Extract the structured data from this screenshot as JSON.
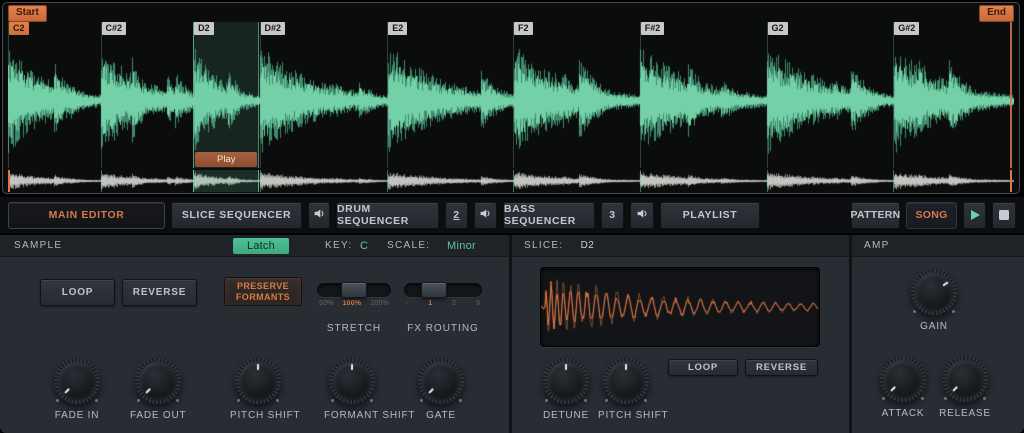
{
  "colors": {
    "accent_orange": "#d9784a",
    "accent_teal": "#5cc8a2",
    "main_wave_dark": "#3f8b6d",
    "main_wave": "#74d0a7",
    "overview_wave_dark": "#8f918d",
    "overview_wave": "#c2c4c0",
    "slice_wave": "#e07a45"
  },
  "waveform_panel": {
    "start_label": "Start",
    "end_label": "End",
    "play_label": "Play",
    "selected_slice": "D2",
    "end_pos": 0.996,
    "slices": [
      {
        "label": "C2",
        "pos": 0.0
      },
      {
        "label": "C#2",
        "pos": 0.092
      },
      {
        "label": "D2",
        "pos": 0.184
      },
      {
        "label": "D#2",
        "pos": 0.25
      },
      {
        "label": "E2",
        "pos": 0.377
      },
      {
        "label": "F2",
        "pos": 0.502
      },
      {
        "label": "F#2",
        "pos": 0.628
      },
      {
        "label": "G2",
        "pos": 0.754
      },
      {
        "label": "G#2",
        "pos": 0.88
      }
    ]
  },
  "tab_bar": {
    "main_editor": "MAIN EDITOR",
    "slice_sequencer": "SLICE SEQUENCER",
    "drum_sequencer": "DRUM SEQUENCER",
    "drum_index": "2",
    "bass_sequencer": "BASS SEQUENCER",
    "bass_index": "3",
    "playlist": "PLAYLIST",
    "pattern": "PATTERN",
    "song": "SONG"
  },
  "sample": {
    "title": "SAMPLE",
    "latch": "Latch",
    "key_label": "KEY:",
    "key_value": "C",
    "scale_label": "SCALE:",
    "scale_value": "Minor",
    "loop": "LOOP",
    "reverse": "REVERSE",
    "preserve_line1": "PRESERVE",
    "preserve_line2": "FORMANTS",
    "stretch": {
      "label": "STRETCH",
      "options": [
        "50%",
        "100%",
        "200%"
      ],
      "selected": "100%",
      "selected_index": 1
    },
    "fx_routing": {
      "label": "FX ROUTING",
      "options": [
        "-",
        "1",
        "2",
        "3"
      ],
      "selected": "1",
      "selected_index": 1
    },
    "knobs": [
      {
        "label": "FADE IN",
        "angle_deg": -135
      },
      {
        "label": "FADE OUT",
        "angle_deg": -135
      },
      {
        "label": "PITCH SHIFT",
        "angle_deg": 0
      },
      {
        "label": "FORMANT SHIFT",
        "angle_deg": 0
      },
      {
        "label": "GATE",
        "angle_deg": -135
      }
    ]
  },
  "slice": {
    "title_label": "SLICE:",
    "title_value": "D2",
    "loop": "LOOP",
    "reverse": "REVERSE",
    "knobs": [
      {
        "label": "DETUNE",
        "angle_deg": 0
      },
      {
        "label": "PITCH SHIFT",
        "angle_deg": 0
      }
    ]
  },
  "amp": {
    "title": "AMP",
    "knobs": [
      {
        "label": "GAIN",
        "angle_deg": 55
      },
      {
        "label": "ATTACK",
        "angle_deg": -135
      },
      {
        "label": "RELEASE",
        "angle_deg": -135
      }
    ]
  }
}
